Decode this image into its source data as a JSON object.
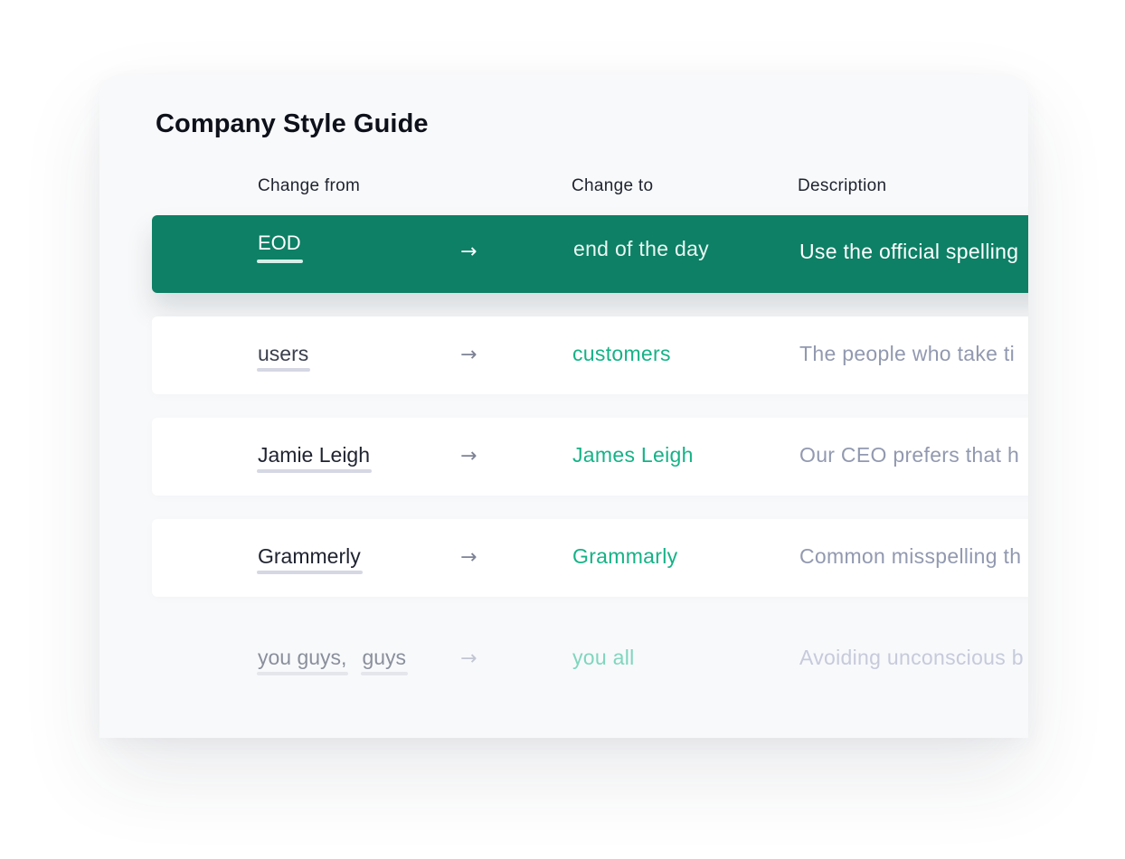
{
  "guide": {
    "title": "Company Style Guide",
    "headers": {
      "from": "Change from",
      "to": "Change to",
      "description": "Description"
    },
    "arrow_glyph": "→",
    "rows": [
      {
        "from": [
          "EOD"
        ],
        "to": "end of the day",
        "description": "Use the official spelling",
        "state": "active"
      },
      {
        "from": [
          "users"
        ],
        "to": "customers",
        "description": "The people who take ti",
        "state": "muted"
      },
      {
        "from": [
          "Jamie Leigh"
        ],
        "to": "James Leigh",
        "description": "Our CEO prefers that h",
        "state": "normal"
      },
      {
        "from": [
          "Grammerly"
        ],
        "to": "Grammarly",
        "description": "Common misspelling th",
        "state": "normal"
      },
      {
        "from": [
          "you guys,",
          "guys"
        ],
        "to": "you all",
        "description": "Avoiding unconscious b",
        "state": "faded"
      }
    ]
  },
  "colors": {
    "accent_green": "#0d8065",
    "replacement_text": "#15b286",
    "description_text": "#9299b0",
    "underline": "#d5d8e3"
  },
  "icons": {
    "arrow": "arrow-right-icon"
  }
}
